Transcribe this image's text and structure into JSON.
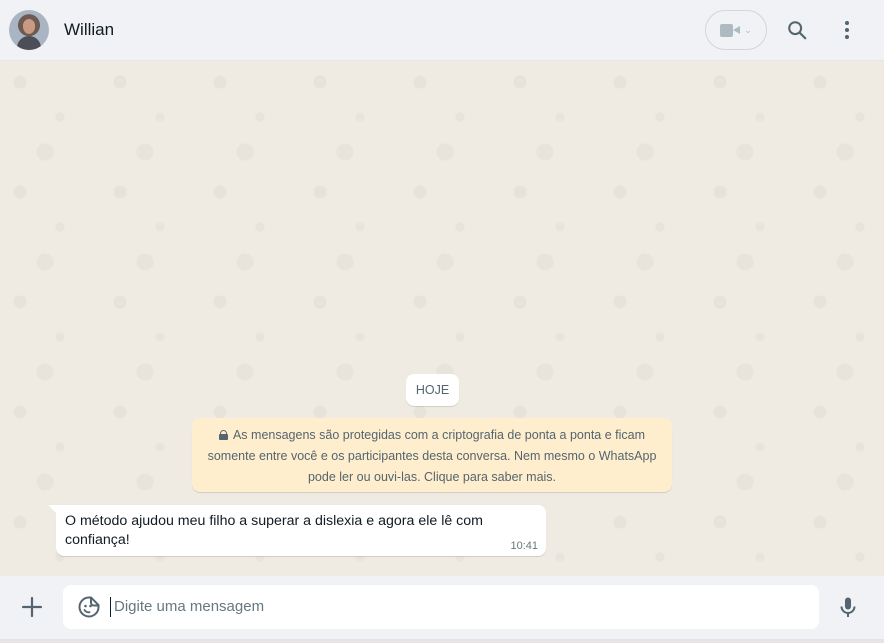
{
  "header": {
    "contact_name": "Willian",
    "icons": {
      "video": "video-camera-icon",
      "search": "search-icon",
      "menu": "more-vertical-icon"
    }
  },
  "chat": {
    "date_chip": "HOJE",
    "encryption_notice": "As mensagens são protegidas com a criptografia de ponta a ponta e ficam somente entre você e os participantes desta conversa. Nem mesmo o WhatsApp pode ler ou ouvi-las. Clique para saber mais.",
    "messages": [
      {
        "direction": "incoming",
        "text": "O método ajudou meu filho a superar a dislexia e agora ele lê com confiança!",
        "time": "10:41"
      }
    ]
  },
  "composer": {
    "placeholder": "Digite uma mensagem",
    "value": ""
  },
  "colors": {
    "header_bg": "#f0f2f5",
    "chat_bg": "#efeae2",
    "notice_bg": "#ffeecd",
    "bubble_bg": "#ffffff",
    "icon": "#54656f"
  }
}
